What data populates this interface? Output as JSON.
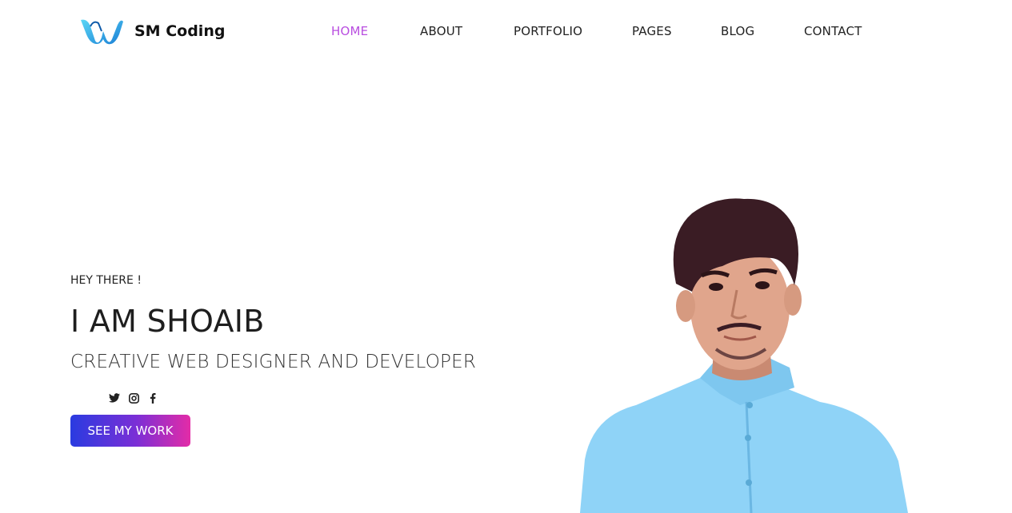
{
  "brand": {
    "name": "SM Coding",
    "logo_icon": "w-ribbon-logo",
    "logo_colors": [
      "#2ec2e8",
      "#1976d2"
    ]
  },
  "nav": {
    "items": [
      {
        "label": "HOME",
        "active": true
      },
      {
        "label": "ABOUT",
        "active": false
      },
      {
        "label": "PORTFOLIO",
        "active": false
      },
      {
        "label": "PAGES",
        "active": false
      },
      {
        "label": "BLOG",
        "active": false
      },
      {
        "label": "CONTACT",
        "active": false
      }
    ],
    "active_color": "#b94ee0"
  },
  "hero": {
    "greeting": "HEY THERE !",
    "title": "I AM SHOAIB",
    "subtitle": "CREATIVE WEB DESIGNER AND DEVELOPER",
    "social": [
      "twitter-icon",
      "instagram-icon",
      "facebook-icon"
    ],
    "cta_label": "SEE MY WORK",
    "cta_gradient": [
      "#2a3be0",
      "#7b2fd6",
      "#e32ca7"
    ]
  }
}
